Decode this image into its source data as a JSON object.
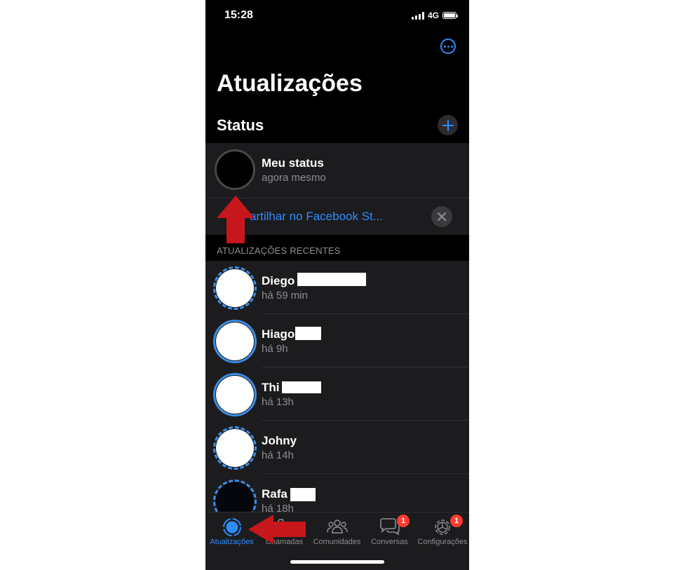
{
  "statusbar": {
    "time": "15:28",
    "network": "4G"
  },
  "header": {
    "title": "Atualizações",
    "more_icon": "ellipsis-circle-icon"
  },
  "status_section": {
    "title": "Status",
    "my_status": {
      "name": "Meu status",
      "time": "agora mesmo"
    },
    "share_text": "artilhar no Facebook St..."
  },
  "recent": {
    "header": "ATUALIZAÇÕES RECENTES",
    "items": [
      {
        "name": "Diego",
        "time": "há 59 min"
      },
      {
        "name": "Hiago",
        "time": "há 9h"
      },
      {
        "name": "Thi",
        "time": "há 13h"
      },
      {
        "name": "Johny",
        "time": "há 14h"
      },
      {
        "name": "Rafa",
        "time": "há 18h"
      }
    ]
  },
  "tabbar": {
    "tabs": [
      {
        "label": "Atualizações",
        "icon": "status-icon",
        "active": true
      },
      {
        "label": "Chamadas",
        "icon": "phone-icon"
      },
      {
        "label": "Comunidades",
        "icon": "people-icon"
      },
      {
        "label": "Conversas",
        "icon": "chat-bubbles-icon",
        "badge": "1"
      },
      {
        "label": "Configurações",
        "icon": "gear-icon",
        "badge": "1"
      }
    ]
  },
  "colors": {
    "accent": "#2f8cff",
    "badge": "#ff3b30",
    "annotation_arrow": "#c8161d"
  }
}
